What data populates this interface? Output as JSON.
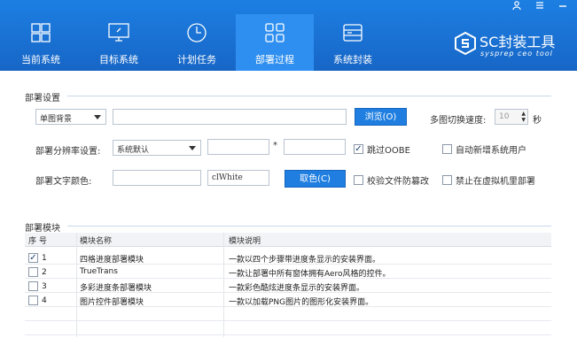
{
  "window_controls": [
    "user-icon",
    "menu-icon",
    "minimize-icon"
  ],
  "nav": {
    "items": [
      {
        "label": "当前系统",
        "icon": "windows-icon"
      },
      {
        "label": "目标系统",
        "icon": "monitor-icon"
      },
      {
        "label": "计划任务",
        "icon": "clock-icon"
      },
      {
        "label": "部署过程",
        "icon": "modules-icon",
        "active": true
      },
      {
        "label": "系统封装",
        "icon": "drive-icon"
      }
    ]
  },
  "logo": {
    "name": "SC封装工具",
    "sub": "sysprep ceo tool"
  },
  "settings": {
    "title": "部署设置",
    "bg_mode": "单图背景",
    "browse_label": "浏览(O)",
    "speed_label": "多图切换速度:",
    "speed_value": "10",
    "speed_unit": "秒",
    "resolution_label": "部署分辨率设置:",
    "resolution_value": "系统默认",
    "resolution_sep": "*",
    "skip_oobe_label": "跳过OOBE",
    "skip_oobe_checked": true,
    "auto_user_label": "自动新增系统用户",
    "text_color_label": "部署文字颜色:",
    "text_color_value": "clWhite",
    "pick_color_label": "取色(C)",
    "verify_label": "校验文件防篡改",
    "no_vm_label": "禁止在虚拟机里部署"
  },
  "modules": {
    "title": "部署模块",
    "columns": [
      "序 号",
      "模块名称",
      "模块说明"
    ],
    "rows": [
      {
        "no": "1",
        "checked": true,
        "name": "四格进度部署模块",
        "desc": "一款以四个步骤带进度条显示的安装界面。"
      },
      {
        "no": "2",
        "checked": false,
        "name": "TrueTrans",
        "desc": "一款让部署中所有窗体拥有Aero风格的控件。"
      },
      {
        "no": "3",
        "checked": false,
        "name": "多彩进度条部署模块",
        "desc": "一款彩色酷炫进度条显示的安装界面。"
      },
      {
        "no": "4",
        "checked": false,
        "name": "图片控件部署模块",
        "desc": "一款以加载PNG图片的图形化安装界面。"
      }
    ]
  }
}
